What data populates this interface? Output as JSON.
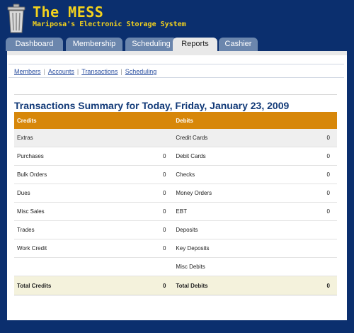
{
  "app": {
    "title": "The MESS",
    "subtitle": "Mariposa's Electronic Storage System",
    "logo_icon": "trash-can-icon",
    "colors": {
      "navy": "#0b2f6e",
      "title_yellow": "#f3d21d",
      "header_orange": "#d7870a"
    }
  },
  "tabs": [
    {
      "label": "Dashboard",
      "active": false
    },
    {
      "label": "Membership",
      "active": false
    },
    {
      "label": "Scheduling",
      "active": false
    },
    {
      "label": "Reports",
      "active": true
    },
    {
      "label": "Cashier",
      "active": false
    }
  ],
  "subnav": [
    "Members",
    "Accounts",
    "Transactions",
    "Scheduling"
  ],
  "summary": {
    "title": "Transactions Summary for Today, Friday, January 23, 2009",
    "credits_header": "Credits",
    "debits_header": "Debits",
    "rows": [
      {
        "credit_label": "Extras",
        "credit_value": "",
        "debit_label": "Credit Cards",
        "debit_value": "0"
      },
      {
        "credit_label": "Purchases",
        "credit_value": "0",
        "debit_label": "Debit Cards",
        "debit_value": "0"
      },
      {
        "credit_label": "Bulk Orders",
        "credit_value": "0",
        "debit_label": "Checks",
        "debit_value": "0"
      },
      {
        "credit_label": "Dues",
        "credit_value": "0",
        "debit_label": "Money Orders",
        "debit_value": "0"
      },
      {
        "credit_label": "Misc Sales",
        "credit_value": "0",
        "debit_label": "EBT",
        "debit_value": "0"
      },
      {
        "credit_label": "Trades",
        "credit_value": "0",
        "debit_label": "Deposits",
        "debit_value": ""
      },
      {
        "credit_label": "Work Credit",
        "credit_value": "0",
        "debit_label": "Key Deposits",
        "debit_value": ""
      },
      {
        "credit_label": "",
        "credit_value": "",
        "debit_label": "Misc Debits",
        "debit_value": ""
      }
    ],
    "total": {
      "credit_label": "Total Credits",
      "credit_value": "0",
      "debit_label": "Total Debits",
      "debit_value": "0"
    }
  }
}
